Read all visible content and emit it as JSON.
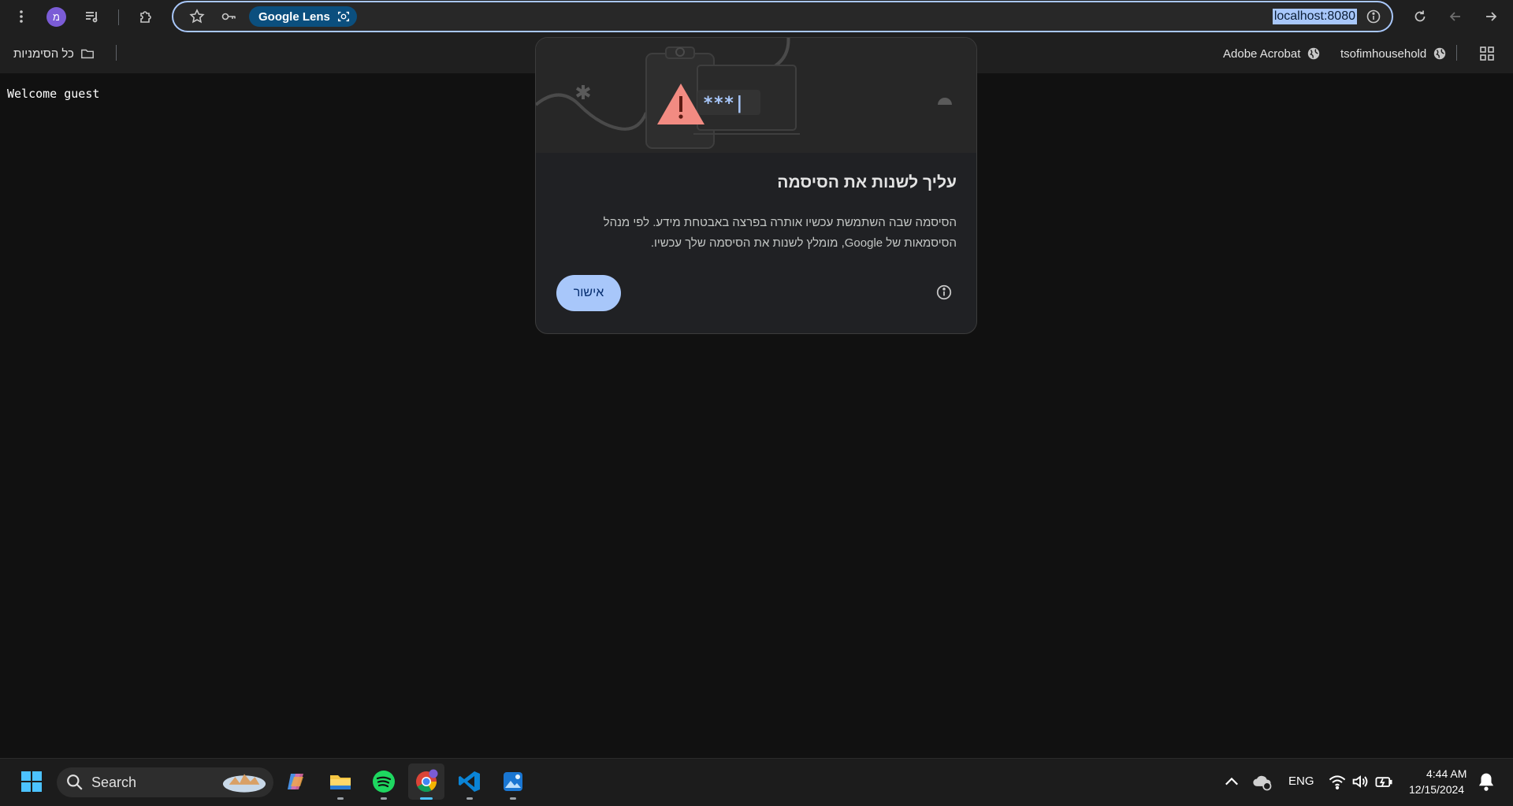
{
  "browser": {
    "profile_initial": "מ",
    "lens_label": "Google Lens",
    "url": "localhost:8080"
  },
  "bookmarks": {
    "all_bookmarks": "כל הסימניות",
    "items": [
      {
        "label": "Adobe Acrobat"
      },
      {
        "label": "tsofimhousehold"
      }
    ]
  },
  "page": {
    "welcome_text": "Welcome guest"
  },
  "dialog": {
    "title": "עליך לשנות את הסיסמה",
    "body_line1": "הסיסמה שבה השתמשת עכשיו אותרה בפרצה באבטחת מידע. לפי מנהל",
    "body_line2": "הסיסמאות של Google, מומלץ לשנות את הסיסמה שלך עכשיו.",
    "ok_label": "אישור",
    "illustration_text": "***|"
  },
  "taskbar": {
    "search_label": "Search",
    "language": "ENG",
    "time": "4:44 AM",
    "date": "12/15/2024"
  },
  "colors": {
    "accent": "#a8c7fa",
    "warning": "#f28b82",
    "avatar": "#7b5cd6"
  }
}
